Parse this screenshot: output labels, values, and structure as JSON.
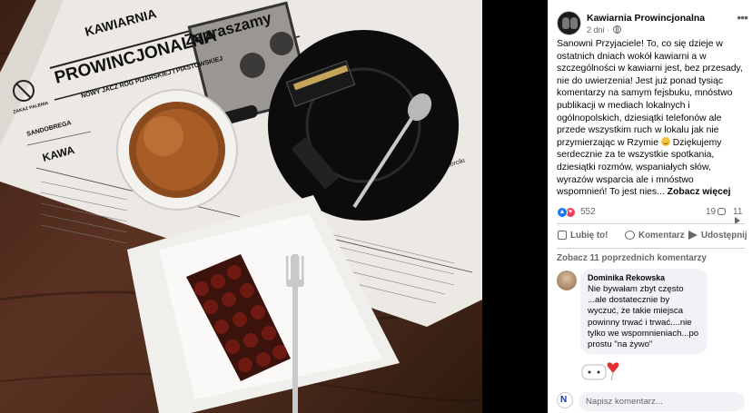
{
  "post": {
    "page_name": "Kawiarnia Prowincjonalna",
    "time": "2 dni ·",
    "text": "Sanowni Przyjaciele! To, co się dzieje w ostatnich dniach wokół kawiarni a w szczególności w kawiarni jest, bez przesady, nie do uwierzenia! Jest już ponad tysiąc komentarzy na samym fejsbuku, mnóstwo publikacji w mediach lokalnych i ogólnopolskich, dziesiątki telefonów ale przede wszystkim ruch w lokalu jak nie przymierzając w Rzymie",
    "text_after_emoji": " Dziękujemy serdecznie za te wszystkie spotkania, dziesiątki rozmów, wspaniałych słów, wyrazów wsparcia ale i mnóstwo wspomnień! To jest nies...",
    "see_more": "Zobacz więcej"
  },
  "reactions": {
    "count": "552",
    "comments": "19",
    "shares": "11"
  },
  "actions": {
    "like": "Lubię to!",
    "comment": "Komentarz",
    "share": "Udostępnij"
  },
  "comments": {
    "previous_link": "Zobacz 11 poprzednich komentarzy",
    "items": [
      {
        "author": "Dominika Rekowska",
        "text": "Nie bywałam zbyt często ...ale dostatecznie by wyczuć, że takie miejsca powinny trwać i trwać....nie tylko we wspomnieniach...po prostu \"na żywo\""
      }
    ],
    "input_placeholder": "Napisz komentarz..."
  },
  "photo": {
    "menu_header": "PROWINCJONALNA",
    "menu_top": "KAWIARNIA",
    "menu_subtitle": "NOWY JACZ RÓG PIJARSKIEJ I PIASTOWSKIEJ",
    "menu_greeting": "Zapraszamy",
    "menu_section": "KAWA",
    "menu_logo": "SANDOBREGA",
    "menu_badge": "ZAKAZ PALENIA",
    "menu_cake": "Ciasta i torciki"
  },
  "colors": {
    "link_blue": "#1877f2",
    "love_red": "#f33e58",
    "text_secondary": "#65676b",
    "bubble_bg": "#f0f2f5"
  }
}
